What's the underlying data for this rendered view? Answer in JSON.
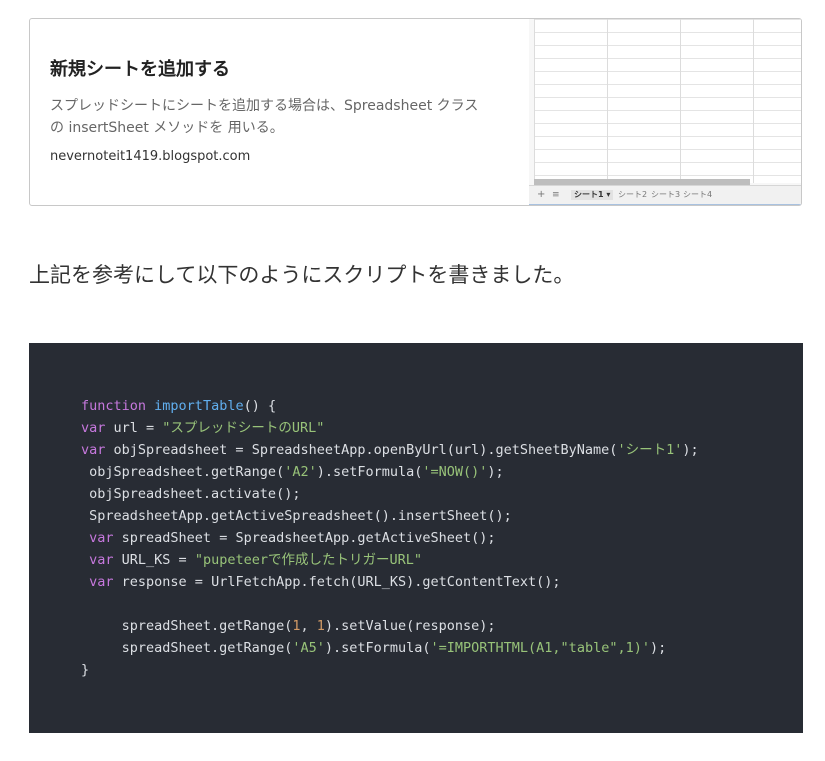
{
  "link_card": {
    "title": "新規シートを追加する",
    "description_line1": "スプレッドシートにシートを追加する場合は、Spreadsheet クラス",
    "description_line2": "の insertSheet メソッドを 用いる。",
    "domain": "nevernoteit1419.blogspot.com",
    "thumbnail": {
      "add_icon": "+",
      "list_icon": "≡",
      "tabs": [
        "シート1 ▾",
        "シート2",
        "シート3",
        "シート4"
      ]
    }
  },
  "paragraph": "上記を参考にして以下のようにスクリプトを書きました。",
  "code": {
    "colors": {
      "background": "#282c34",
      "keyword": "#c678dd",
      "function": "#61afef",
      "string": "#98c379",
      "number": "#d19a66",
      "text": "#dcdfe4"
    },
    "lines": [
      [
        {
          "t": "function",
          "c": "kw"
        },
        {
          "t": " "
        },
        {
          "t": "importTable",
          "c": "fn"
        },
        {
          "t": "() {"
        }
      ],
      [
        {
          "t": "var",
          "c": "kw"
        },
        {
          "t": " url = "
        },
        {
          "t": "\"スプレッドシートのURL\"",
          "c": "str"
        }
      ],
      [
        {
          "t": "var",
          "c": "kw"
        },
        {
          "t": " objSpreadsheet = SpreadsheetApp.openByUrl(url).getSheetByName("
        },
        {
          "t": "'シート1'",
          "c": "str"
        },
        {
          "t": ");"
        }
      ],
      [
        {
          "t": " objSpreadsheet.getRange("
        },
        {
          "t": "'A2'",
          "c": "str"
        },
        {
          "t": ").setFormula("
        },
        {
          "t": "'=NOW()'",
          "c": "str"
        },
        {
          "t": ");"
        }
      ],
      [
        {
          "t": " objSpreadsheet.activate();"
        }
      ],
      [
        {
          "t": " SpreadsheetApp.getActiveSpreadsheet().insertSheet();"
        }
      ],
      [
        {
          "t": " "
        },
        {
          "t": "var",
          "c": "kw"
        },
        {
          "t": " spreadSheet = SpreadsheetApp.getActiveSheet();"
        }
      ],
      [
        {
          "t": " "
        },
        {
          "t": "var",
          "c": "kw"
        },
        {
          "t": " URL_KS = "
        },
        {
          "t": "\"pupeteerで作成したトリガーURL\"",
          "c": "str"
        }
      ],
      [
        {
          "t": " "
        },
        {
          "t": "var",
          "c": "kw"
        },
        {
          "t": " response = UrlFetchApp.fetch(URL_KS).getContentText();"
        }
      ],
      [],
      [
        {
          "t": "     spreadSheet.getRange("
        },
        {
          "t": "1",
          "c": "num"
        },
        {
          "t": ", "
        },
        {
          "t": "1",
          "c": "num"
        },
        {
          "t": ").setValue(response);"
        }
      ],
      [
        {
          "t": "     spreadSheet.getRange("
        },
        {
          "t": "'A5'",
          "c": "str"
        },
        {
          "t": ").setFormula("
        },
        {
          "t": "'=IMPORTHTML(A1,\"table\",1)'",
          "c": "str"
        },
        {
          "t": ");"
        }
      ],
      [
        {
          "t": "}"
        }
      ]
    ]
  }
}
